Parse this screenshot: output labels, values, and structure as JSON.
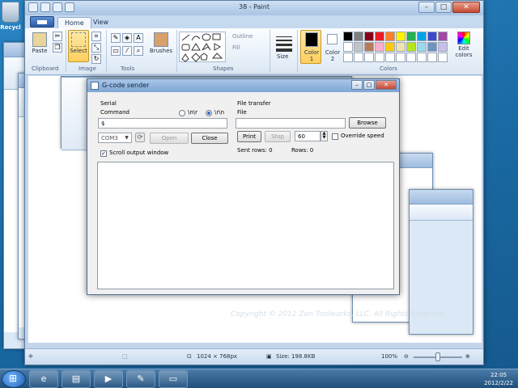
{
  "desktop": {
    "recycle_label": "Recycl",
    "watermark": "Copyright © 2012 Zen Toolworks, LLC. All Rights Reserved."
  },
  "paint": {
    "title": "38 - Paint",
    "tabs": [
      "Home",
      "View"
    ],
    "groups": {
      "clipboard": "Clipboard",
      "image": "Image",
      "tools": "Tools",
      "shapes": "Shapes",
      "colors": "Colors"
    },
    "buttons": {
      "paste": "Paste",
      "select": "Select",
      "brushes": "Brushes",
      "outline": "Outline",
      "fill": "Fill",
      "size": "Size",
      "color1": "Color 1",
      "color2": "Color 2",
      "edit_colors": "Edit colors"
    },
    "palette": [
      "#000000",
      "#7f7f7f",
      "#880015",
      "#ed1c24",
      "#ff7f27",
      "#fff200",
      "#22b14c",
      "#00a2e8",
      "#3f48cc",
      "#a349a4",
      "#ffffff",
      "#c3c3c3",
      "#b97a57",
      "#ffaec9",
      "#ffc90e",
      "#efe4b0",
      "#b5e61d",
      "#99d9ea",
      "#7092be",
      "#c8bfe7",
      "#ffffff",
      "#ffffff",
      "#ffffff",
      "#ffffff",
      "#ffffff",
      "#ffffff",
      "#ffffff",
      "#ffffff",
      "#ffffff",
      "#ffffff"
    ],
    "color1_value": "#000000",
    "color2_value": "#ffffff",
    "status": {
      "dimensions": "1024 × 768px",
      "size": "Size: 198.8KB",
      "zoom": "100%"
    }
  },
  "gcode": {
    "title": "G-code sender",
    "serial": {
      "section": "Serial",
      "command_label": "Command",
      "radio_nr": "\\n\\r",
      "radio_rn": "\\r\\n",
      "command_value": "$",
      "port": "COM3",
      "open_button": "Open",
      "close_button": "Close",
      "scroll_output": "Scroll output window"
    },
    "file": {
      "section": "File transfer",
      "file_label": "File",
      "file_value": "",
      "browse_button": "Browse",
      "print_button": "Print",
      "stop_button": "Stop",
      "speed_value": "60",
      "override_speed": "Override speed",
      "sent_rows": "Sent rows: 0",
      "rows": "Rows: 0"
    }
  },
  "taskbar": {
    "time": "22:05",
    "date": "2012/2/22"
  }
}
